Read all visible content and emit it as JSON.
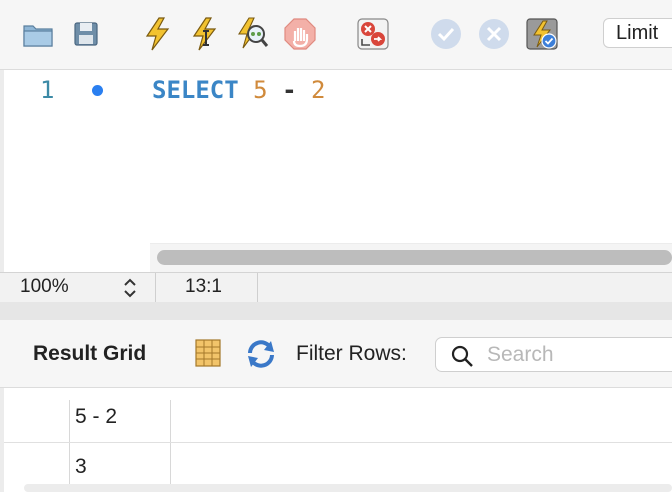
{
  "toolbar": {
    "buttons": [
      {
        "name": "open-folder-icon"
      },
      {
        "name": "save-icon"
      },
      {
        "name": "execute-all-icon"
      },
      {
        "name": "execute-current-icon"
      },
      {
        "name": "explain-query-icon"
      },
      {
        "name": "stop-icon"
      },
      {
        "name": "stop-on-error-icon"
      },
      {
        "name": "commit-icon"
      },
      {
        "name": "rollback-icon"
      },
      {
        "name": "autocommit-icon"
      }
    ],
    "limit_label": "Limit"
  },
  "editor": {
    "line_number": "1",
    "code": {
      "keyword": "SELECT",
      "left": "5",
      "operator": "-",
      "right": "2"
    }
  },
  "status_bar": {
    "zoom": "100%",
    "cursor_position": "13:1"
  },
  "result_toolbar": {
    "title": "Result Grid",
    "filter_label": "Filter Rows:",
    "search_placeholder": "Search"
  },
  "result_grid": {
    "columns": [
      "5 - 2"
    ],
    "rows": [
      [
        "3"
      ]
    ]
  },
  "colors": {
    "keyword": "#3b86c6",
    "number": "#d08a3b",
    "line_number": "#3c8aa6",
    "line_marker": "#2a7ff0"
  }
}
